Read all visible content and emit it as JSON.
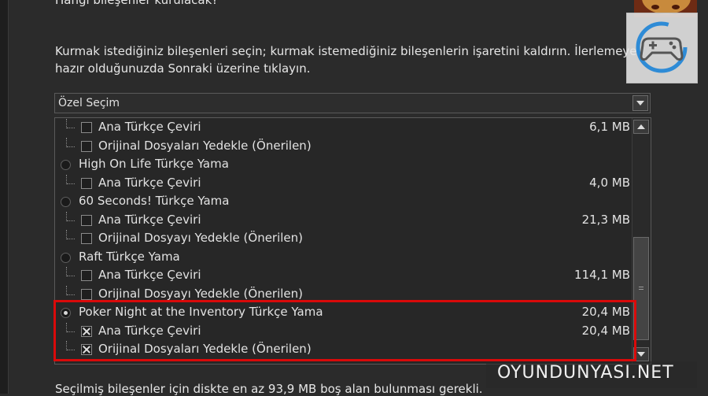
{
  "page": {
    "title": "Hangi bileşenler kurulacak?",
    "description": "Kurmak istediğiniz bileşenleri seçin; kurmak istemediğiniz bileşenlerin işaretini kaldırın. İlerlemeye hazır olduğunuzda Sonraki üzerine tıklayın.",
    "footer": "Seçilmiş bileşenler için diskte en az 93,9 MB boş alan bulunması gerekli."
  },
  "setup_type": {
    "selected": "Özel Seçim"
  },
  "components": [
    {
      "label": "Ana Türkçe Çeviri",
      "size": "6,1 MB",
      "kind": "checkbox",
      "checked": false
    },
    {
      "label": "Orijinal Dosyaları Yedekle (Önerilen)",
      "size": "",
      "kind": "checkbox",
      "checked": false
    },
    {
      "label": "High On Life Türkçe Yama",
      "size": "",
      "kind": "radio",
      "checked": false
    },
    {
      "label": "Ana Türkçe Çeviri",
      "size": "4,0 MB",
      "kind": "checkbox",
      "checked": false
    },
    {
      "label": "60 Seconds! Türkçe Yama",
      "size": "",
      "kind": "radio",
      "checked": false
    },
    {
      "label": "Ana Türkçe Çeviri",
      "size": "21,3 MB",
      "kind": "checkbox",
      "checked": false
    },
    {
      "label": "Orijinal Dosyayı Yedekle (Önerilen)",
      "size": "",
      "kind": "checkbox",
      "checked": false
    },
    {
      "label": "Raft Türkçe Yama",
      "size": "",
      "kind": "radio",
      "checked": false
    },
    {
      "label": "Ana Türkçe Çeviri",
      "size": "114,1 MB",
      "kind": "checkbox",
      "checked": false
    },
    {
      "label": "Orijinal Dosyayı Yedekle (Önerilen)",
      "size": "",
      "kind": "checkbox",
      "checked": false
    },
    {
      "label": "Poker Night at the Inventory Türkçe Yama",
      "size": "20,4 MB",
      "kind": "radio",
      "checked": true
    },
    {
      "label": "Ana Türkçe Çeviri",
      "size": "20,4 MB",
      "kind": "checkbox",
      "checked": true
    },
    {
      "label": "Orijinal Dosyaları Yedekle (Önerilen)",
      "size": "",
      "kind": "checkbox",
      "checked": true
    }
  ],
  "watermark": {
    "text": "OYUNDUNYASI.NET"
  },
  "colors": {
    "highlight": "#d90a0a",
    "background": "#2b2b2b"
  },
  "icons": {
    "logo": "gamepad-icon",
    "dropdown": "chevron-down-icon"
  }
}
